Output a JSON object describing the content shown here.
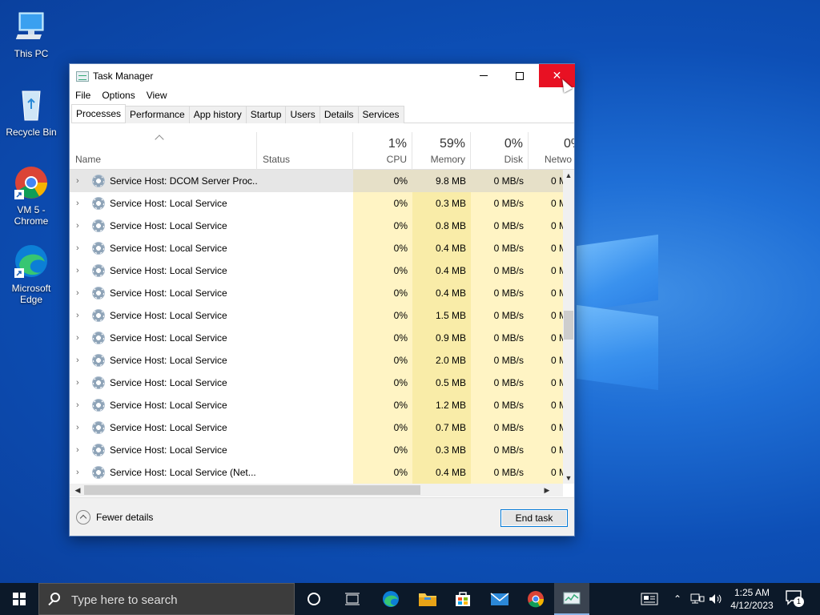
{
  "desktop": {
    "icons": [
      {
        "label": "This PC"
      },
      {
        "label": "Recycle Bin"
      },
      {
        "label": "VM 5 - Chrome"
      },
      {
        "label": "Microsoft Edge"
      }
    ]
  },
  "window": {
    "title": "Task Manager",
    "menu": [
      "File",
      "Options",
      "View"
    ],
    "tabs": [
      "Processes",
      "Performance",
      "App history",
      "Startup",
      "Users",
      "Details",
      "Services"
    ],
    "active_tab": "Processes",
    "columns": {
      "name": "Name",
      "status": "Status",
      "cpu": {
        "pct": "1%",
        "label": "CPU"
      },
      "memory": {
        "pct": "59%",
        "label": "Memory"
      },
      "disk": {
        "pct": "0%",
        "label": "Disk"
      },
      "network": {
        "pct": "0%",
        "label": "Netwo"
      }
    },
    "rows": [
      {
        "name": "Service Host: DCOM Server Proc...",
        "cpu": "0%",
        "memory": "9.8 MB",
        "disk": "0 MB/s",
        "net": "0 M"
      },
      {
        "name": "Service Host: Local Service",
        "cpu": "0%",
        "memory": "0.3 MB",
        "disk": "0 MB/s",
        "net": "0 M"
      },
      {
        "name": "Service Host: Local Service",
        "cpu": "0%",
        "memory": "0.8 MB",
        "disk": "0 MB/s",
        "net": "0 M"
      },
      {
        "name": "Service Host: Local Service",
        "cpu": "0%",
        "memory": "0.4 MB",
        "disk": "0 MB/s",
        "net": "0 M"
      },
      {
        "name": "Service Host: Local Service",
        "cpu": "0%",
        "memory": "0.4 MB",
        "disk": "0 MB/s",
        "net": "0 M"
      },
      {
        "name": "Service Host: Local Service",
        "cpu": "0%",
        "memory": "0.4 MB",
        "disk": "0 MB/s",
        "net": "0 M"
      },
      {
        "name": "Service Host: Local Service",
        "cpu": "0%",
        "memory": "1.5 MB",
        "disk": "0 MB/s",
        "net": "0 M"
      },
      {
        "name": "Service Host: Local Service",
        "cpu": "0%",
        "memory": "0.9 MB",
        "disk": "0 MB/s",
        "net": "0 M"
      },
      {
        "name": "Service Host: Local Service",
        "cpu": "0%",
        "memory": "2.0 MB",
        "disk": "0 MB/s",
        "net": "0 M"
      },
      {
        "name": "Service Host: Local Service",
        "cpu": "0%",
        "memory": "0.5 MB",
        "disk": "0 MB/s",
        "net": "0 M"
      },
      {
        "name": "Service Host: Local Service",
        "cpu": "0%",
        "memory": "1.2 MB",
        "disk": "0 MB/s",
        "net": "0 M"
      },
      {
        "name": "Service Host: Local Service",
        "cpu": "0%",
        "memory": "0.7 MB",
        "disk": "0 MB/s",
        "net": "0 M"
      },
      {
        "name": "Service Host: Local Service",
        "cpu": "0%",
        "memory": "0.3 MB",
        "disk": "0 MB/s",
        "net": "0 M"
      },
      {
        "name": "Service Host: Local Service (Net...",
        "cpu": "0%",
        "memory": "0.4 MB",
        "disk": "0 MB/s",
        "net": "0 M"
      }
    ],
    "footer": {
      "fewer_details": "Fewer details",
      "end_task": "End task"
    }
  },
  "taskbar": {
    "search_placeholder": "Type here to search",
    "clock_time": "1:25 AM",
    "clock_date": "4/12/2023",
    "notification_count": "1"
  },
  "colors": {
    "accent": "#0078d7",
    "close": "#e81123",
    "cpu_heat": "#fff4c4",
    "mem_heat": "#f9eca8"
  }
}
